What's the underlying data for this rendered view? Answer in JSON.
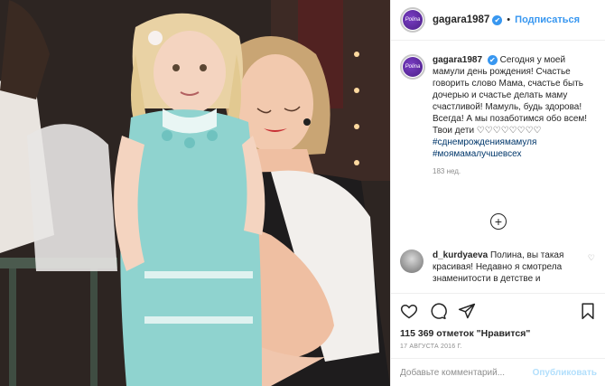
{
  "post": {
    "username": "gagara1987",
    "verified_mark": "✔",
    "separator": "•",
    "follow_label": "Подписаться",
    "avatar_text": "Polina"
  },
  "caption": {
    "username": "gagara1987",
    "text": "Сегодня у моей мамули день рождения! Счастье говорить слово Мама, счастье быть дочерью и счастье делать маму счастливой! Мамуль, будь здорова! Всегда! А мы позаботимся обо всем! Твои дети ♡♡♡♡♡♡♡♡",
    "hashtags": [
      "#сднемрождениямамуля",
      "#моямамалучшевсех"
    ],
    "time_ago": "183 нед."
  },
  "load_more": {
    "label": "+"
  },
  "comment": {
    "username": "d_kurdyaeva",
    "text": "Полина, вы такая красивая! Недавно я смотрела знаменитости в детстве и",
    "like_icon": "♡"
  },
  "actions": {
    "icons": [
      "heart-icon",
      "comment-icon",
      "share-icon",
      "bookmark-icon"
    ],
    "likes_label": "115 369 отметок \"Нравится\"",
    "date": "17 АВГУСТА 2016 Г."
  },
  "add_comment": {
    "placeholder": "Добавьте комментарий...",
    "publish_label": "Опубликовать"
  },
  "colors": {
    "accent": "#3897f0",
    "hashtag": "#00376b",
    "muted": "#8e8e8e",
    "publish_disabled": "#b2dffc"
  }
}
